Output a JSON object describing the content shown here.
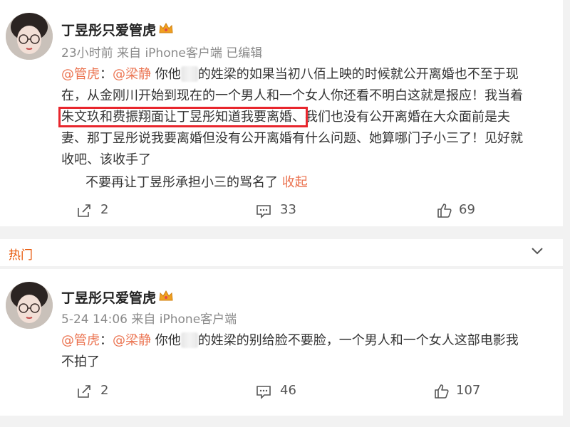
{
  "posts": [
    {
      "username": "丁昱彤只爱管虎",
      "meta": "23小时前 来自 iPhone客户端 已编辑",
      "mention1": "@管虎",
      "sep": "：",
      "mention2": "@梁静",
      "text_a": "你他",
      "text_b": "的姓梁的如果当初八佰上映的时候就公开离婚也不至于现",
      "line2": "在，从金刚川开始到现在的一个男人和一个女人你还看不明白这就是报应！我当着",
      "line3_highlight": "朱文玖和费振翔面让丁昱彤知道我要离婚、",
      "line3_rest": "我们也没有公开离婚在大众面前是夫",
      "line4": "妻、那丁昱彤说我要离婚但没有公开离婚有什么问题、她算哪门子小三了！见好就",
      "line5": "收吧、该收手了",
      "subline": "不要再让丁昱彤承担小三的骂名了",
      "collapse": "收起",
      "reposts": "2",
      "comments": "33",
      "likes": "69"
    },
    {
      "username": "丁昱彤只爱管虎",
      "meta": "5-24 14:06 来自 iPhone客户端",
      "mention1": "@管虎",
      "sep": "：",
      "mention2": "@梁静",
      "text_a": "你他",
      "text_b": "的姓梁的别给脸不要脸，一个男人和一个女人这部电影我",
      "line2": "不拍了",
      "reposts": "2",
      "comments": "46",
      "likes": "107"
    }
  ],
  "section": {
    "hot_label": "热门"
  },
  "colors": {
    "accent": "#eb7350",
    "highlight_box": "#e8262d",
    "hot": "#e8590c"
  },
  "icons": [
    "avatar",
    "crown-badge-icon",
    "repost-icon",
    "comment-icon",
    "like-icon",
    "chevron-down-icon"
  ]
}
